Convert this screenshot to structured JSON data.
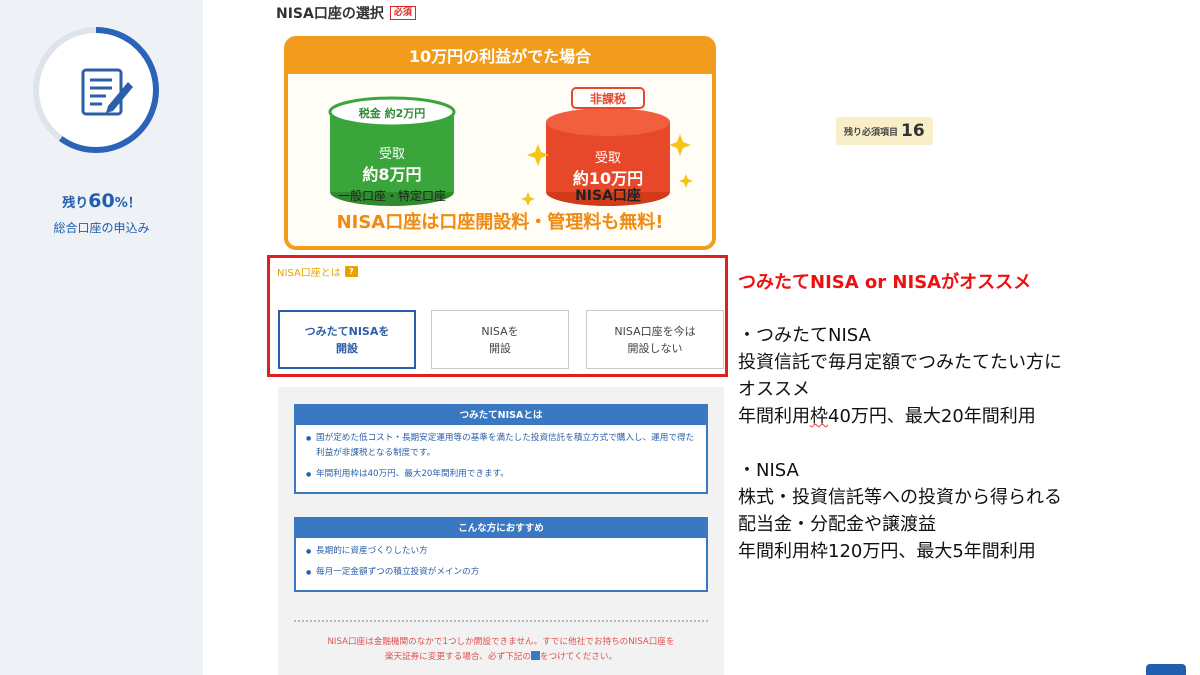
{
  "progress": {
    "remain_prefix": "残り",
    "remain_value": "60",
    "remain_suffix": "%！",
    "subtitle": "総合口座の申込み",
    "fraction_remaining": 0.6
  },
  "section": {
    "title": "NISA口座の選択",
    "required_label": "必須"
  },
  "banner": {
    "heading": "10万円の利益がでた場合",
    "general": {
      "tax_prefix": "税金",
      "tax_value": "約2万円",
      "receive_label": "受取",
      "receive_value": "約8万円",
      "account_label": "一般口座・特定口座"
    },
    "nisa": {
      "tax_label": "非課税",
      "receive_label": "受取",
      "receive_value": "約10万円",
      "account_label": "NISA口座"
    },
    "footer": "NISA口座は口座開設料・管理料も無料!"
  },
  "remaining_required": {
    "label": "残り必須項目",
    "count": "16"
  },
  "nisa_choice": {
    "about_link": "NISA口座とは",
    "help_icon": "?",
    "options": [
      {
        "label": "つみたてNISAを\n開設",
        "selected": true
      },
      {
        "label": "NISAを\n開設",
        "selected": false
      },
      {
        "label": "NISA口座を今は\n開設しない",
        "selected": false
      }
    ]
  },
  "info": {
    "tsumitate_card": {
      "heading": "つみたてNISAとは",
      "items": [
        "国が定めた低コスト・長期安定運用等の基準を満たした投資信託を積立方式で購入し、運用で得た利益が非課税となる制度です。",
        "年間利用枠は40万円、最大20年間利用できます。"
      ]
    },
    "recommend_card": {
      "heading": "こんな方におすすめ",
      "items": [
        "長期的に資産づくりしたい方",
        "毎月一定金額ずつの積立投資がメインの方"
      ]
    },
    "note_line1": "NISA口座は金融機関のなかで1つしか開設できません。すでに他社でお持ちのNISA口座を",
    "note_line2a": "楽天証券に変更する場合、必ず下記の",
    "note_line2b": "をつけてください。"
  },
  "annotation": {
    "title": "つみたてNISA or NISAがオススメ",
    "tsumitate_head": "・つみたてNISA",
    "tsumitate_line1": "投資信託で毎月定額でつみたてたい方に",
    "tsumitate_line2": "オススメ",
    "tsumitate_line3_a": "年間利用",
    "tsumitate_line3_b": "枠",
    "tsumitate_line3_c": "40万円、最大20年間利用",
    "nisa_head": "・NISA",
    "nisa_line1": "株式・投資信託等への投資から得られる",
    "nisa_line2": "配当金・分配金や譲渡益",
    "nisa_line3": "年間利用枠120万円、最大5年間利用"
  },
  "colors": {
    "brand_blue": "#1f5fae",
    "banner_orange": "#f39b1c",
    "highlight_red": "#e02020",
    "card_blue": "#3a78c2"
  }
}
